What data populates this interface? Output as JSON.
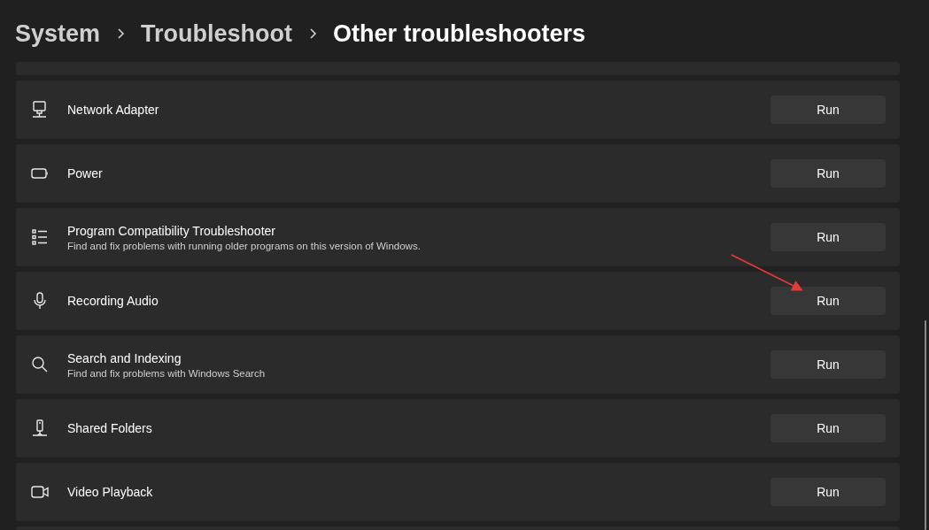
{
  "breadcrumb": [
    {
      "label": "System",
      "current": false
    },
    {
      "label": "Troubleshoot",
      "current": false
    },
    {
      "label": "Other troubleshooters",
      "current": true
    }
  ],
  "troubleshooters": [
    {
      "title": "Network Adapter",
      "button": "Run"
    },
    {
      "title": "Power",
      "button": "Run"
    },
    {
      "title": "Program Compatibility Troubleshooter",
      "description": "Find and fix problems with running older programs on this version of Windows.",
      "button": "Run"
    },
    {
      "title": "Recording Audio",
      "button": "Run"
    },
    {
      "title": "Search and Indexing",
      "description": "Find and fix problems with Windows Search",
      "button": "Run"
    },
    {
      "title": "Shared Folders",
      "button": "Run"
    },
    {
      "title": "Video Playback",
      "button": "Run"
    }
  ]
}
